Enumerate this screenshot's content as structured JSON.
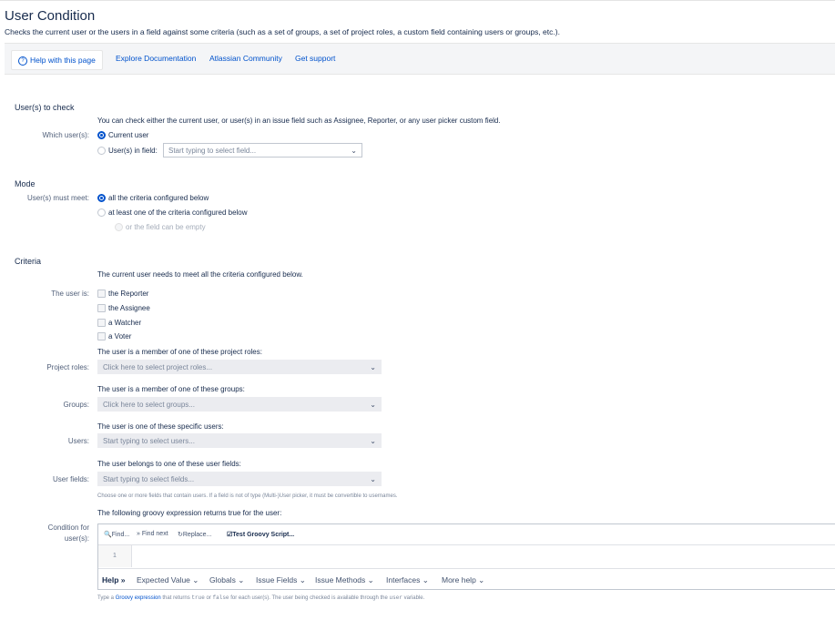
{
  "page": {
    "title": "User Condition",
    "subtitle": "Checks the current user or the users in a field against some criteria (such as a set of groups, a set of project roles, a custom field containing users or groups, etc.)."
  },
  "helpbar": {
    "help_label": "Help with this page",
    "links": [
      "Explore Documentation",
      "Atlassian Community",
      "Get support"
    ]
  },
  "users_to_check": {
    "heading": "User(s) to check",
    "description": "You can check either the current user, or user(s) in an issue field such as Assignee, Reporter, or any user picker custom field.",
    "label": "Which user(s):",
    "option_current": "Current user",
    "option_field": "User(s) in field:",
    "field_placeholder": "Start typing to select field..."
  },
  "mode": {
    "heading": "Mode",
    "label": "User(s) must meet:",
    "option_all": "all the criteria configured below",
    "option_one": "at least one of the criteria configured below",
    "option_empty": "or the field can be empty"
  },
  "criteria": {
    "heading": "Criteria",
    "description": "The current user needs to meet all the criteria configured below.",
    "user_is_label": "The user is:",
    "user_is_options": [
      "the Reporter",
      "the Assignee",
      "a Watcher",
      "a Voter"
    ],
    "roles_desc": "The user is a member of one of these project roles:",
    "roles_label": "Project roles:",
    "roles_placeholder": "Click here to select project roles...",
    "groups_desc": "The user is a member of one of these groups:",
    "groups_label": "Groups:",
    "groups_placeholder": "Click here to select groups...",
    "users_desc": "The user is one of these specific users:",
    "users_label": "Users:",
    "users_placeholder": "Start typing to select users...",
    "fields_desc": "The user belongs to one of these user fields:",
    "fields_label": "User fields:",
    "fields_placeholder": "Start typing to select fields...",
    "fields_note": "Choose one or more fields that contain users. If a field is not of type (Multi-)User picker, it must be convertible to usernames.",
    "groovy_desc": "The following groovy expression returns true for the user:",
    "groovy_label_1": "Condition for",
    "groovy_label_2": "user(s):"
  },
  "editor": {
    "find": "Find...",
    "find_next": "Find next",
    "replace": "Replace...",
    "test": "Test Groovy Script...",
    "line_number": "1",
    "help_items": [
      "Help",
      "Expected Value",
      "Globals",
      "Issue Fields",
      "Issue Methods",
      "Interfaces",
      "More help"
    ],
    "footer_pre": "Type a",
    "footer_link": "Groovy expression",
    "footer_mid": "that returns",
    "footer_true": "true",
    "footer_or": "or",
    "footer_false": "false",
    "footer_post": "for each user(s). The user being checked is available through the",
    "footer_var": "user",
    "footer_end": "variable."
  }
}
